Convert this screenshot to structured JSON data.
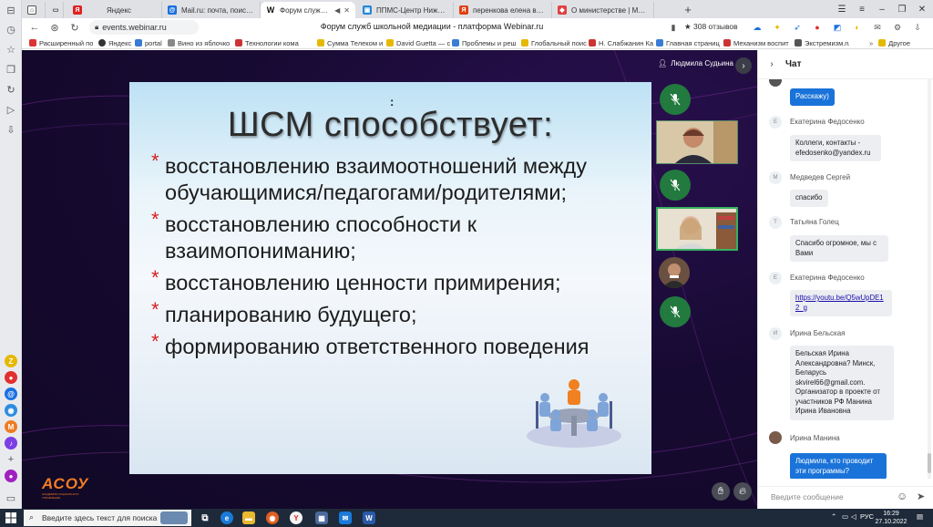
{
  "tabs": [
    {
      "label": "Яндекс",
      "color": "#e02020"
    },
    {
      "label": "Mail.ru: почта, поиск в ин",
      "color": "#1b6fe0"
    },
    {
      "label": "Форум служб школьн",
      "color": "#ffffff",
      "active": true
    },
    {
      "label": "ППМС-Центр Нижегород",
      "color": "#2486d9"
    },
    {
      "label": "перенкова елена виктор",
      "color": "#e04010"
    },
    {
      "label": "О министерстве | Минис",
      "color": "#e04040"
    }
  ],
  "address": {
    "url": "events.webinar.ru",
    "page_title": "Форум служб школьной медиации - платформа Webinar.ru",
    "reviews": "308 отзывов"
  },
  "bookmarks": [
    {
      "label": "Расширенный по",
      "color": "#d33"
    },
    {
      "label": "Яндекс",
      "color": "#333"
    },
    {
      "label": "portal",
      "color": "#3a7bd5"
    },
    {
      "label": "Вино из яблочко",
      "color": "#888"
    },
    {
      "label": "Технологии кома",
      "color": "#c33"
    },
    {
      "label": "Сумма Телеком и",
      "color": "#e6b800"
    },
    {
      "label": "David Guetta — c",
      "color": "#e6b800"
    },
    {
      "label": "Проблемы и реш",
      "color": "#3a7bd5"
    },
    {
      "label": "Глобальный поис",
      "color": "#e6b800"
    },
    {
      "label": "Н. Слабжанин Ка",
      "color": "#c33"
    },
    {
      "label": "Главная страниц",
      "color": "#3a7bd5"
    },
    {
      "label": "Механизм воспит",
      "color": "#c33"
    },
    {
      "label": "Экстремизм.ru",
      "color": "#555"
    },
    {
      "label": "Другое",
      "color": "#e6b800"
    }
  ],
  "webinar": {
    "speaker_name": "Людмила Судьина",
    "slide": {
      "colon": ":",
      "title": "ШСМ способствует:",
      "bullets": [
        "восстановлению  взаимоотношений между обучающимися/педагогами/родителями;",
        "восстановлению способности к взаимопониманию;",
        "восстановлению ценности примирения;",
        "планированию будущего;",
        "формированию ответственного поведения"
      ]
    },
    "logo": "АСОУ",
    "logo_sub": "АКАДЕМИЯ СОЦИАЛЬНОГО УПРАВЛЕНИЯ"
  },
  "chat": {
    "title": "Чат",
    "input_placeholder": "Введите сообщение",
    "messages": [
      {
        "initial": "",
        "author": "",
        "text": "Расскажу)",
        "me": true
      },
      {
        "initial": "Е",
        "author": "Екатерина Федосенко",
        "text": "Коллеги, контакты - efedosenko@yandex.ru"
      },
      {
        "initial": "М",
        "author": "Медведев Сергей",
        "text": "спасибо"
      },
      {
        "initial": "Т",
        "author": "Татьяна Голец",
        "text": "Спасибо огромное, мы с Вами"
      },
      {
        "initial": "Е",
        "author": "Екатерина Федосенко",
        "link": "https://youtu.be/Q5wUpDE12_g"
      },
      {
        "initial": "И",
        "author": "Ирина Бельская",
        "text": "Бельская Ирина Александровна? Минск, Беларусь skvirel66@gmail.com. Организатор в проекте от участников РФ Манина Ирина Ивановна"
      },
      {
        "initial": "",
        "author": "Ирина Манина",
        "text": "Людмила, кто проводит эти программы?",
        "me": true
      }
    ]
  },
  "taskbar": {
    "search_placeholder": "Введите здесь текст для поиска",
    "lang": "РУС",
    "time": "16:29",
    "date": "27.10.2022"
  }
}
